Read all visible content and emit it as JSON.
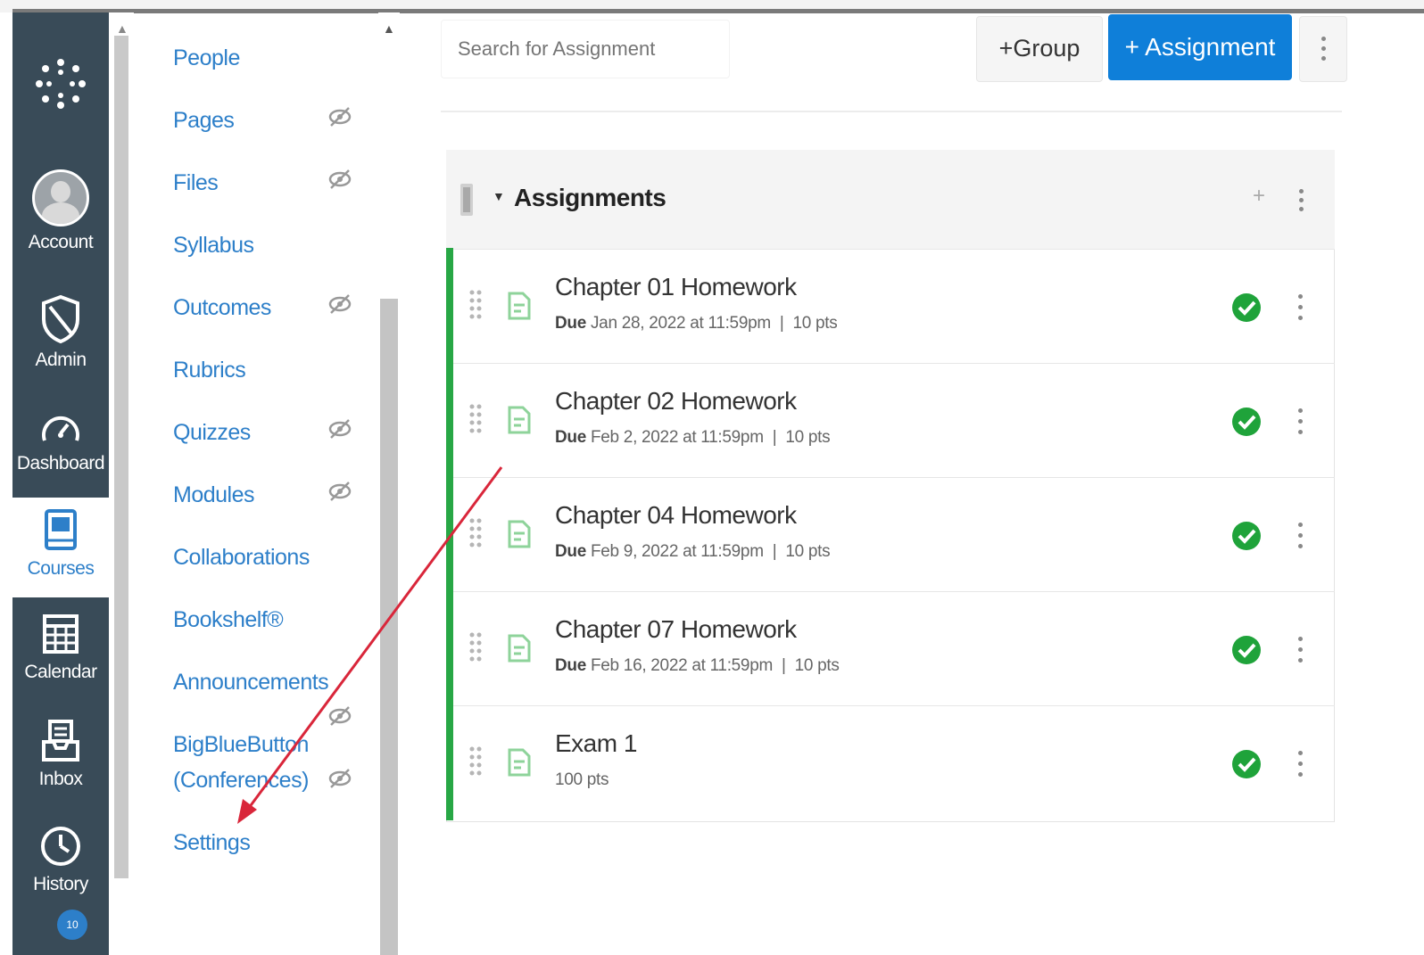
{
  "global_nav": {
    "items": [
      {
        "label": "Account",
        "icon": "account-avatar"
      },
      {
        "label": "Admin",
        "icon": "shield-icon"
      },
      {
        "label": "Dashboard",
        "icon": "dashboard-gauge-icon"
      },
      {
        "label": "Courses",
        "icon": "courses-book-icon",
        "active": true
      },
      {
        "label": "Calendar",
        "icon": "calendar-icon"
      },
      {
        "label": "Inbox",
        "icon": "inbox-icon"
      },
      {
        "label": "History",
        "icon": "clock-icon"
      }
    ],
    "badge": "10"
  },
  "course_nav": {
    "items": [
      {
        "label": "People",
        "hidden": false
      },
      {
        "label": "Pages",
        "hidden": true
      },
      {
        "label": "Files",
        "hidden": true
      },
      {
        "label": "Syllabus",
        "hidden": false
      },
      {
        "label": "Outcomes",
        "hidden": true
      },
      {
        "label": "Rubrics",
        "hidden": false
      },
      {
        "label": "Quizzes",
        "hidden": true
      },
      {
        "label": "Modules",
        "hidden": true
      },
      {
        "label": "Collaborations",
        "hidden": false
      },
      {
        "label": "Bookshelf®",
        "hidden": false
      },
      {
        "label": "Announcements",
        "hidden": true
      },
      {
        "label": "BigBlueButton",
        "hidden": false
      },
      {
        "label": "(Conferences)",
        "hidden": true
      },
      {
        "label": "Settings",
        "hidden": false
      }
    ]
  },
  "toolbar": {
    "search_placeholder": "Search for Assignment",
    "group_button": "+Group",
    "assignment_button": "+ Assignment"
  },
  "assignment_group": {
    "title": "Assignments",
    "add_symbol": "+",
    "items": [
      {
        "title": "Chapter 01 Homework",
        "due_label": "Due",
        "due": "Jan 28, 2022 at 11:59pm",
        "sep": "|",
        "points": "10 pts"
      },
      {
        "title": "Chapter 02 Homework",
        "due_label": "Due",
        "due": "Feb 2, 2022 at 11:59pm",
        "sep": "|",
        "points": "10 pts"
      },
      {
        "title": "Chapter 04 Homework",
        "due_label": "Due",
        "due": "Feb 9, 2022 at 11:59pm",
        "sep": "|",
        "points": "10 pts"
      },
      {
        "title": "Chapter 07 Homework",
        "due_label": "Due",
        "due": "Feb 16, 2022 at 11:59pm",
        "sep": "|",
        "points": "10 pts"
      },
      {
        "title": "Exam 1",
        "due_label": "",
        "due": "",
        "sep": "",
        "points": "100 pts"
      }
    ]
  },
  "colors": {
    "nav_bg": "#394b58",
    "link_blue": "#2d7fc9",
    "primary_button": "#0f7fd9",
    "published_green": "#28a745",
    "annotation_arrow": "#d9263a"
  }
}
